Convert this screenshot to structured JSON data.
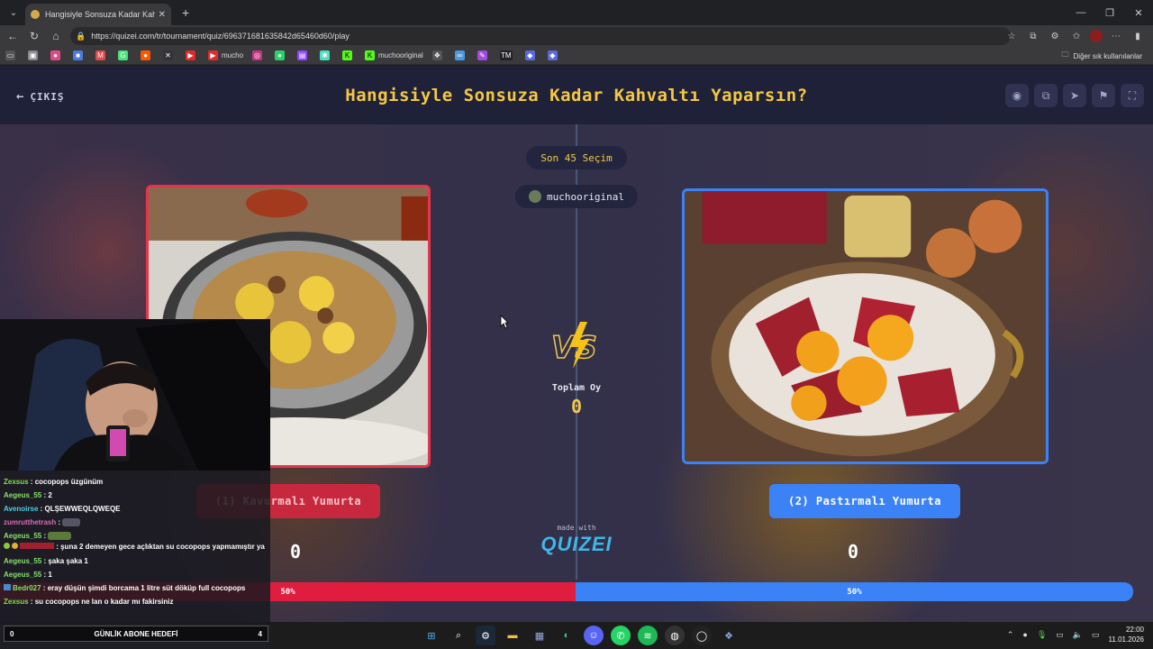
{
  "browser": {
    "tab_title": "Hangisiyle Sonsuza Kadar Kahvaltı",
    "url": "https://quizei.com/tr/tournament/quiz/696371681635842d65460d60/play",
    "bookmarks": [
      "mucho",
      "muchooriginal"
    ],
    "bookmarks_right": "Diğer sık kullanılanlar",
    "tm_label": "TM"
  },
  "header": {
    "exit_label": "ÇIKIŞ",
    "title": "Hangisiyle Sonsuza Kadar Kahvaltı Yaparsın?"
  },
  "round": {
    "badge": "Son 45 Seçim",
    "user": "muchooriginal",
    "total_label": "Toplam Oy",
    "total_value": "0"
  },
  "choices": {
    "left": {
      "label": "(1) Kavurmalı Yumurta",
      "count": "0",
      "percent_label": "50%",
      "percent": 50
    },
    "right": {
      "label": "(2) Pastırmalı Yumurta",
      "count": "0",
      "percent_label": "50%",
      "percent": 50
    }
  },
  "branding": {
    "made_with": "made with",
    "logo": "QUIZEI"
  },
  "chat": [
    {
      "user": "Zexsus",
      "color": "#7ee04a",
      "text": " : cocopops üzgünüm"
    },
    {
      "user": "Aegeus_55",
      "color": "#86e06a",
      "text": " : 2"
    },
    {
      "user": "Avenoirse",
      "color": "#4ad0e0",
      "text": " : QLŞEWWEQLQWEQE"
    },
    {
      "user": "zumrutthetrash",
      "color": "#d96ab8",
      "text": " : "
    },
    {
      "user": "Aegeus_55",
      "color": "#86e06a",
      "text": " : "
    },
    {
      "user": "",
      "color": "#e0404a",
      "text": " : şuna 2 demeyen gece açlıktan su cocopops yapmamıştır ya"
    },
    {
      "user": "Aegeus_55",
      "color": "#86e06a",
      "text": " : şaka şaka 1"
    },
    {
      "user": "Aegeus_55",
      "color": "#86e06a",
      "text": " : 1"
    },
    {
      "user": "Bedr027",
      "color": "#86e06a",
      "text": " : eray düşün şimdi borcama 1 litre süt döküp full cocopops"
    },
    {
      "user": "Zexsus",
      "color": "#7ee04a",
      "text": " : su cocopops ne lan o kadar mı fakirsiniz"
    }
  ],
  "goal": {
    "left": "0",
    "label": "GÜNLİK ABONE HEDEFİ",
    "right": "4"
  },
  "clock": {
    "time": "22:00",
    "date": "11.01.2026"
  }
}
